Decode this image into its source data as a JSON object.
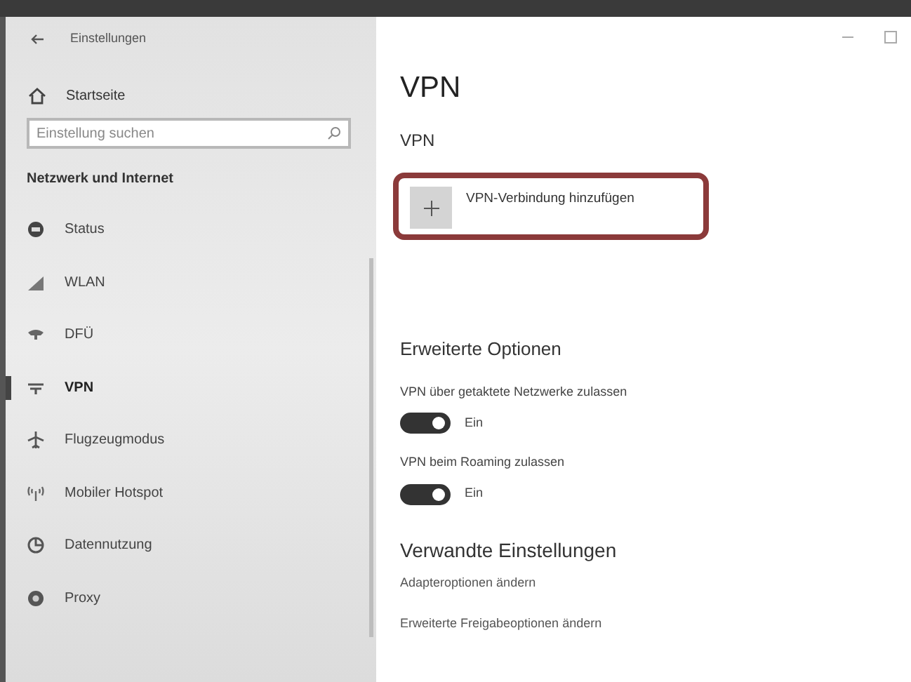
{
  "window": {
    "title": "Einstellungen"
  },
  "sidebar": {
    "home": "Startseite",
    "search": {
      "placeholder": "Einstellung suchen"
    },
    "section": "Netzwerk und Internet",
    "items": [
      {
        "label": "Status",
        "selected": false
      },
      {
        "label": "WLAN",
        "selected": false
      },
      {
        "label": "DFÜ",
        "selected": false
      },
      {
        "label": "VPN",
        "selected": true
      },
      {
        "label": "Flugzeugmodus",
        "selected": false
      },
      {
        "label": "Mobiler Hotspot",
        "selected": false
      },
      {
        "label": "Datennutzung",
        "selected": false
      },
      {
        "label": "Proxy",
        "selected": false
      }
    ]
  },
  "content": {
    "title": "VPN",
    "subtitle": "VPN",
    "add_button": {
      "label": "VPN-Verbindung hinzufügen",
      "highlighted": true
    },
    "advanced": {
      "heading": "Erweiterte Optionen",
      "options": [
        {
          "label": "VPN über getaktete Netzwerke zulassen",
          "on": true,
          "state": "Ein"
        },
        {
          "label": "VPN beim Roaming zulassen",
          "on": true,
          "state": "Ein"
        }
      ]
    },
    "related": {
      "heading": "Verwandte Einstellungen",
      "links": [
        "Adapteroptionen ändern",
        "Erweiterte Freigabeoptionen ändern"
      ]
    }
  }
}
